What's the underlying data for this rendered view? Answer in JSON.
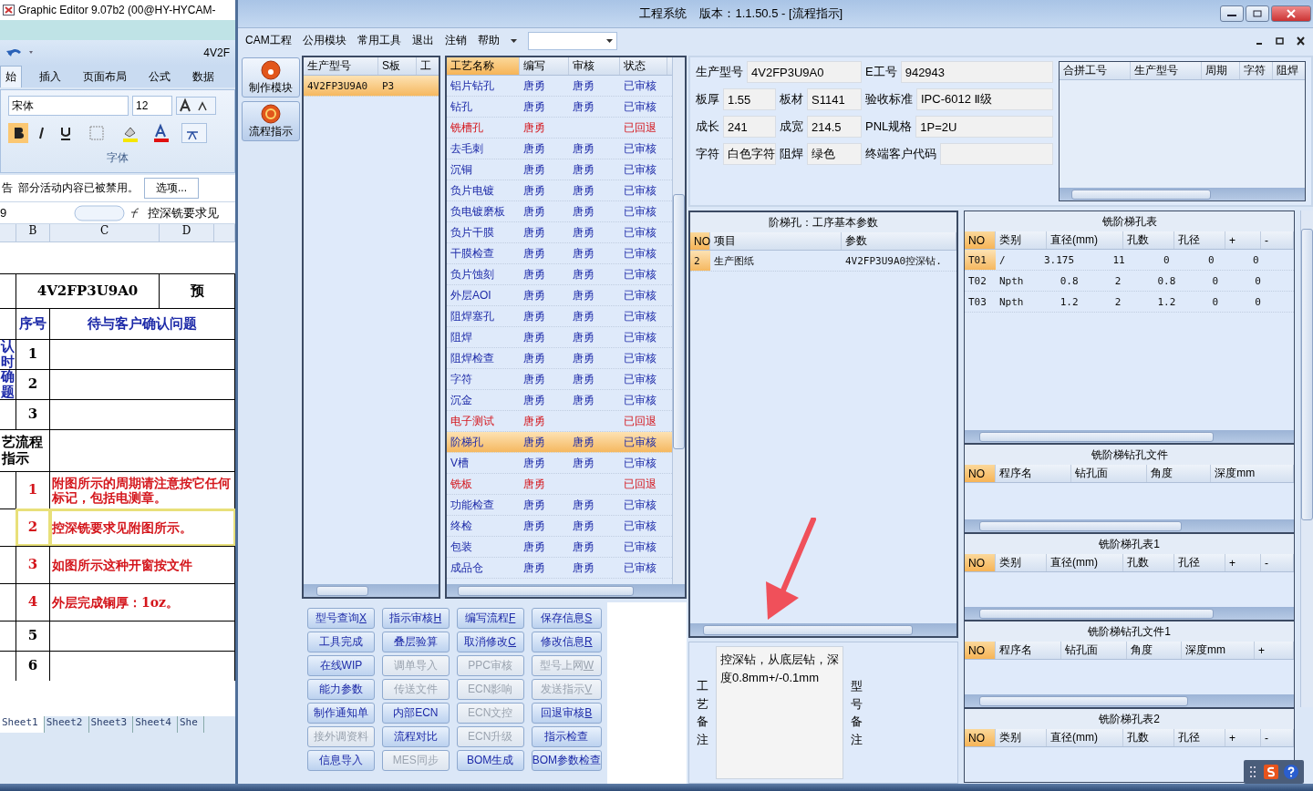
{
  "excel": {
    "back_title": "Graphic Editor 9.07b2 (00@HY-HYCAM-",
    "doc_title": "4V2F",
    "ribbon_tabs": [
      {
        "label": "始",
        "selected": true
      },
      {
        "label": "插入",
        "selected": false
      },
      {
        "label": "页面布局",
        "selected": false
      },
      {
        "label": "公式",
        "selected": false
      },
      {
        "label": "数据",
        "selected": false
      }
    ],
    "font_name": "宋体",
    "font_size": "12",
    "font_group": "字体",
    "security_message": "部分活动内容已被禁用。",
    "options_button": "选项...",
    "security_prefix": "告",
    "name_box": "9",
    "formula": "控深铣要求见",
    "columns": [
      "B",
      "C",
      "D"
    ],
    "rows": [
      {
        "a": "",
        "b": "",
        "c": "4V2FP3U9A0",
        "d": "预",
        "kind": "title"
      },
      {
        "a": "",
        "b": "序号",
        "c": "待与客户确认问题",
        "d": "",
        "kind": "header"
      },
      {
        "a": "认时",
        "b": "1",
        "c": "",
        "d": "",
        "kind": "plain"
      },
      {
        "a": "确题",
        "b": "2",
        "c": "",
        "d": "",
        "kind": "plain"
      },
      {
        "a": "",
        "b": "3",
        "c": "",
        "d": "",
        "kind": "plain"
      },
      {
        "a": "艺流程指示",
        "b": "",
        "c": "",
        "d": "",
        "kind": "section"
      },
      {
        "a": "",
        "b": "1",
        "c": "附图所示的周期请注意按它任何标记，包括电测章。",
        "d": "",
        "kind": "note",
        "selected": false
      },
      {
        "a": "",
        "b": "2",
        "c": "控深铣要求见附图所示。",
        "d": "",
        "kind": "note",
        "selected": true
      },
      {
        "a": "",
        "b": "3",
        "c": "如图所示这种开窗按文件",
        "d": "",
        "kind": "note",
        "selected": false
      },
      {
        "a": "",
        "b": "4",
        "c": "外层完成铜厚：1oz。",
        "d": "",
        "kind": "note",
        "selected": false
      },
      {
        "a": "",
        "b": "5",
        "c": "",
        "d": "",
        "kind": "plain"
      },
      {
        "a": "",
        "b": "6",
        "c": "",
        "d": "",
        "kind": "plain"
      }
    ],
    "sheets": [
      {
        "label": "Sheet1",
        "selected": true
      },
      {
        "label": "Sheet2",
        "selected": false
      },
      {
        "label": "Sheet3",
        "selected": false
      },
      {
        "label": "Sheet4",
        "selected": false
      },
      {
        "label": "She",
        "selected": false
      }
    ]
  },
  "window": {
    "title": "工程系统    版本：1.1.50.5 - [流程指示]"
  },
  "menu": [
    "CAM工程",
    "公用模块",
    "常用工具",
    "退出",
    "注销",
    "帮助"
  ],
  "sidebar": [
    {
      "label": "制作模块",
      "selected": false
    },
    {
      "label": "流程指示",
      "selected": true
    }
  ],
  "model_table": {
    "columns": [
      "生产型号",
      "S板",
      "工"
    ],
    "rows": [
      {
        "cells": [
          "4V2FP3U9A0",
          "P3",
          ""
        ],
        "selected": true
      }
    ]
  },
  "process_table": {
    "columns": [
      "工艺名称",
      "编写",
      "审核",
      "状态"
    ],
    "rows": [
      {
        "name": "铝片钻孔",
        "writer": "唐勇",
        "reviewer": "唐勇",
        "status": "已审核",
        "returned": false,
        "selected": false
      },
      {
        "name": "钻孔",
        "writer": "唐勇",
        "reviewer": "唐勇",
        "status": "已审核",
        "returned": false,
        "selected": false
      },
      {
        "name": "铣槽孔",
        "writer": "唐勇",
        "reviewer": "",
        "status": "已回退",
        "returned": true,
        "selected": false
      },
      {
        "name": "去毛刺",
        "writer": "唐勇",
        "reviewer": "唐勇",
        "status": "已审核",
        "returned": false,
        "selected": false
      },
      {
        "name": "沉铜",
        "writer": "唐勇",
        "reviewer": "唐勇",
        "status": "已审核",
        "returned": false,
        "selected": false
      },
      {
        "name": "负片电镀",
        "writer": "唐勇",
        "reviewer": "唐勇",
        "status": "已审核",
        "returned": false,
        "selected": false
      },
      {
        "name": "负电镀磨板",
        "writer": "唐勇",
        "reviewer": "唐勇",
        "status": "已审核",
        "returned": false,
        "selected": false
      },
      {
        "name": "负片干膜",
        "writer": "唐勇",
        "reviewer": "唐勇",
        "status": "已审核",
        "returned": false,
        "selected": false
      },
      {
        "name": "干膜检查",
        "writer": "唐勇",
        "reviewer": "唐勇",
        "status": "已审核",
        "returned": false,
        "selected": false
      },
      {
        "name": "负片蚀刻",
        "writer": "唐勇",
        "reviewer": "唐勇",
        "status": "已审核",
        "returned": false,
        "selected": false
      },
      {
        "name": "外层AOI",
        "writer": "唐勇",
        "reviewer": "唐勇",
        "status": "已审核",
        "returned": false,
        "selected": false
      },
      {
        "name": "阻焊塞孔",
        "writer": "唐勇",
        "reviewer": "唐勇",
        "status": "已审核",
        "returned": false,
        "selected": false
      },
      {
        "name": "阻焊",
        "writer": "唐勇",
        "reviewer": "唐勇",
        "status": "已审核",
        "returned": false,
        "selected": false
      },
      {
        "name": "阻焊检查",
        "writer": "唐勇",
        "reviewer": "唐勇",
        "status": "已审核",
        "returned": false,
        "selected": false
      },
      {
        "name": "字符",
        "writer": "唐勇",
        "reviewer": "唐勇",
        "status": "已审核",
        "returned": false,
        "selected": false
      },
      {
        "name": "沉金",
        "writer": "唐勇",
        "reviewer": "唐勇",
        "status": "已审核",
        "returned": false,
        "selected": false
      },
      {
        "name": "电子测试",
        "writer": "唐勇",
        "reviewer": "",
        "status": "已回退",
        "returned": true,
        "selected": false
      },
      {
        "name": "阶梯孔",
        "writer": "唐勇",
        "reviewer": "唐勇",
        "status": "已审核",
        "returned": false,
        "selected": true
      },
      {
        "name": "V槽",
        "writer": "唐勇",
        "reviewer": "唐勇",
        "status": "已审核",
        "returned": false,
        "selected": false
      },
      {
        "name": "铣板",
        "writer": "唐勇",
        "reviewer": "",
        "status": "已回退",
        "returned": true,
        "selected": false
      },
      {
        "name": "功能检查",
        "writer": "唐勇",
        "reviewer": "唐勇",
        "status": "已审核",
        "returned": false,
        "selected": false
      },
      {
        "name": "终检",
        "writer": "唐勇",
        "reviewer": "唐勇",
        "status": "已审核",
        "returned": false,
        "selected": false
      },
      {
        "name": "包装",
        "writer": "唐勇",
        "reviewer": "唐勇",
        "status": "已审核",
        "returned": false,
        "selected": false
      },
      {
        "name": "成品仓",
        "writer": "唐勇",
        "reviewer": "唐勇",
        "status": "已审核",
        "returned": false,
        "selected": false
      }
    ]
  },
  "buttons": [
    {
      "label": "型号查询",
      "hotkey": "X",
      "disabled": false
    },
    {
      "label": "指示审核",
      "hotkey": "H",
      "disabled": false
    },
    {
      "label": "编写流程",
      "hotkey": "F",
      "disabled": false
    },
    {
      "label": "保存信息",
      "hotkey": "S",
      "disabled": false
    },
    {
      "label": "工具完成",
      "disabled": false
    },
    {
      "label": "叠层验算",
      "disabled": false
    },
    {
      "label": "取消修改",
      "hotkey": "C",
      "disabled": false
    },
    {
      "label": "修改信息",
      "hotkey": "R",
      "disabled": false
    },
    {
      "label": "在线WIP",
      "disabled": false
    },
    {
      "label": "调单导入",
      "disabled": true
    },
    {
      "label": "PPC审核",
      "disabled": true
    },
    {
      "label": "型号上网",
      "hotkey": "W",
      "disabled": true
    },
    {
      "label": "能力参数",
      "disabled": false
    },
    {
      "label": "传送文件",
      "disabled": true
    },
    {
      "label": "ECN影响",
      "disabled": true
    },
    {
      "label": "发送指示",
      "hotkey": "V",
      "disabled": true
    },
    {
      "label": "制作通知单",
      "disabled": false
    },
    {
      "label": "内部ECN",
      "disabled": false
    },
    {
      "label": "ECN文控",
      "disabled": true
    },
    {
      "label": "回退审核",
      "hotkey": "B",
      "disabled": false
    },
    {
      "label": "接外调资料",
      "disabled": true
    },
    {
      "label": "流程对比",
      "disabled": false
    },
    {
      "label": "ECN升级",
      "disabled": true
    },
    {
      "label": "指示检查",
      "disabled": false
    },
    {
      "label": "信息导入",
      "disabled": false
    },
    {
      "label": "MES同步",
      "disabled": true
    },
    {
      "label": "BOM生成",
      "disabled": false
    },
    {
      "label": "BOM参数检查",
      "disabled": false
    }
  ],
  "info": [
    [
      {
        "label": "生产型号",
        "value": "4V2FP3U9A0"
      },
      {
        "label": "E工号",
        "value": "942943"
      }
    ],
    [
      {
        "label": "板厚",
        "value": "1.55"
      },
      {
        "label": "板材",
        "value": "S1141"
      },
      {
        "label": "验收标准",
        "value": "IPC-6012 Ⅱ级"
      }
    ],
    [
      {
        "label": "成长",
        "value": "241"
      },
      {
        "label": "成宽",
        "value": "214.5"
      },
      {
        "label": "PNL规格",
        "value": "1P=2U"
      }
    ],
    [
      {
        "label": "字符",
        "value": "白色字符"
      },
      {
        "label": "阻焊",
        "value": "绿色"
      },
      {
        "label": "终端客户代码"
      }
    ]
  ],
  "merge_table": {
    "columns": [
      "合拼工号",
      "生产型号",
      "周期",
      "字符",
      "阻焊"
    ]
  },
  "param_panel": {
    "title": "阶梯孔：工序基本参数",
    "columns": [
      "NO",
      "项目",
      "参数"
    ],
    "rows": [
      {
        "cells": [
          "2",
          "生产图纸",
          "4V2FP3U9A0控深钻."
        ],
        "selected": true
      }
    ]
  },
  "remarks": {
    "process_label": "工艺备注",
    "process_text": "控深钻，从底层钻，深度0.8mm+/-0.1mm",
    "model_label": "型号备注"
  },
  "right_tables": [
    {
      "title": "铣阶梯孔表",
      "columns": [
        "NO",
        "类别",
        "直径(mm)",
        "孔数",
        "孔径",
        "+",
        "-"
      ],
      "rows": [
        {
          "cells": [
            "T01",
            "/",
            "3.175",
            "11",
            "0",
            "0",
            "0"
          ],
          "selected": true
        },
        {
          "cells": [
            "T02",
            "Npth",
            "0.8",
            "2",
            "0.8",
            "0",
            "0"
          ],
          "selected": false
        },
        {
          "cells": [
            "T03",
            "Npth",
            "1.2",
            "2",
            "1.2",
            "0",
            "0"
          ],
          "selected": false
        }
      ]
    },
    {
      "title": "铣阶梯钻孔文件",
      "columns": [
        "NO",
        "程序名",
        "钻孔面",
        "角度",
        "深度mm"
      ]
    },
    {
      "title": "铣阶梯孔表1",
      "columns": [
        "NO",
        "类别",
        "直径(mm)",
        "孔数",
        "孔径",
        "+",
        "-"
      ]
    },
    {
      "title": "铣阶梯钻孔文件1",
      "columns": [
        "NO",
        "程序名",
        "钻孔面",
        "角度",
        "深度mm",
        "+"
      ]
    },
    {
      "title": "铣阶梯孔表2",
      "columns": [
        "NO",
        "类别",
        "直径(mm)",
        "孔数",
        "孔径",
        "+",
        "-"
      ]
    }
  ]
}
